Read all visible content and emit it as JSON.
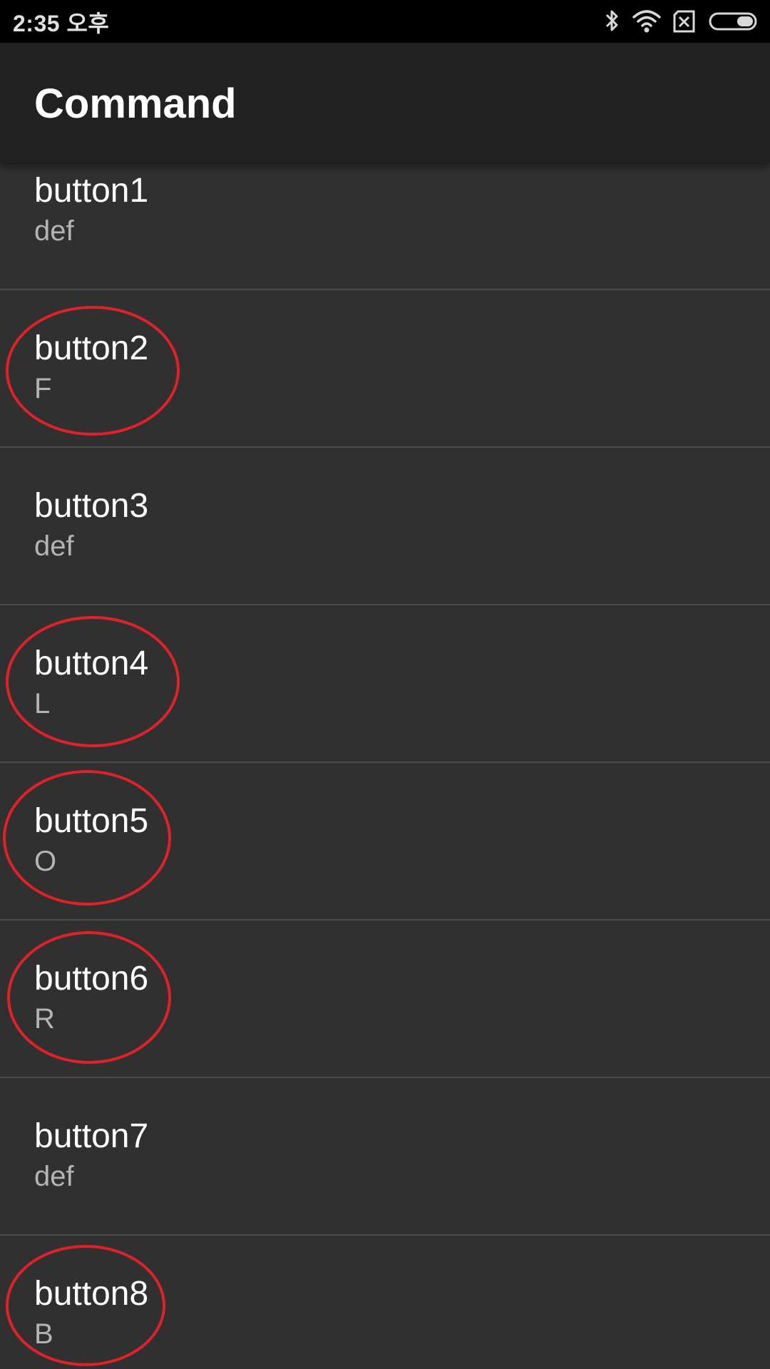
{
  "status_bar": {
    "time": "2:35 오후",
    "icons": [
      "bluetooth-icon",
      "wifi-icon",
      "no-sim-icon",
      "battery-icon"
    ]
  },
  "app_bar": {
    "title": "Command"
  },
  "list": {
    "items": [
      {
        "title": "button1",
        "subtitle": "def",
        "annotated": false
      },
      {
        "title": "button2",
        "subtitle": "F",
        "annotated": true
      },
      {
        "title": "button3",
        "subtitle": "def",
        "annotated": false
      },
      {
        "title": "button4",
        "subtitle": "L",
        "annotated": true
      },
      {
        "title": "button5",
        "subtitle": "O",
        "annotated": true
      },
      {
        "title": "button6",
        "subtitle": "R",
        "annotated": true
      },
      {
        "title": "button7",
        "subtitle": "def",
        "annotated": false
      },
      {
        "title": "button8",
        "subtitle": "B",
        "annotated": true
      }
    ]
  },
  "colors": {
    "status_bar_bg": "#000000",
    "app_bar_bg": "#212121",
    "list_bg": "#303030",
    "annotation": "#e0202a"
  }
}
